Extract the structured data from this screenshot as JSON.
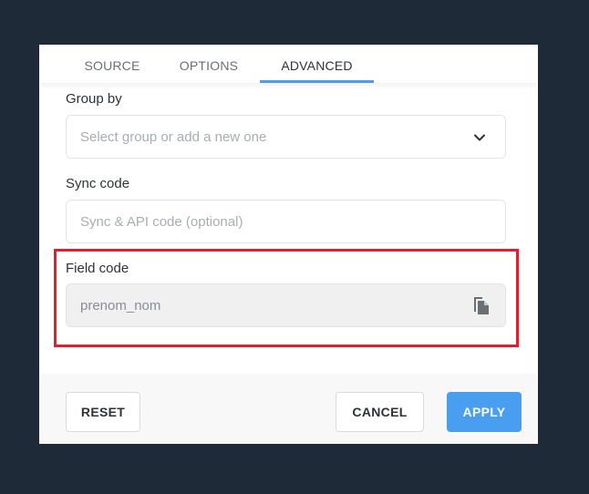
{
  "tabs": [
    {
      "label": "SOURCE",
      "active": false
    },
    {
      "label": "OPTIONS",
      "active": false
    },
    {
      "label": "ADVANCED",
      "active": true
    }
  ],
  "group_by": {
    "label": "Group by",
    "placeholder": "Select group or add a new one"
  },
  "sync_code": {
    "label": "Sync code",
    "placeholder": "Sync & API code (optional)"
  },
  "field_code": {
    "label": "Field code",
    "value": "prenom_nom"
  },
  "footer": {
    "reset_label": "RESET",
    "cancel_label": "CANCEL",
    "apply_label": "APPLY"
  },
  "colors": {
    "accent": "#4a9ef0",
    "highlight": "#e0202e",
    "backdrop": "#1e2a38"
  },
  "icons": {
    "dropdown": "chevron-down-icon",
    "copy": "copy-icon"
  }
}
